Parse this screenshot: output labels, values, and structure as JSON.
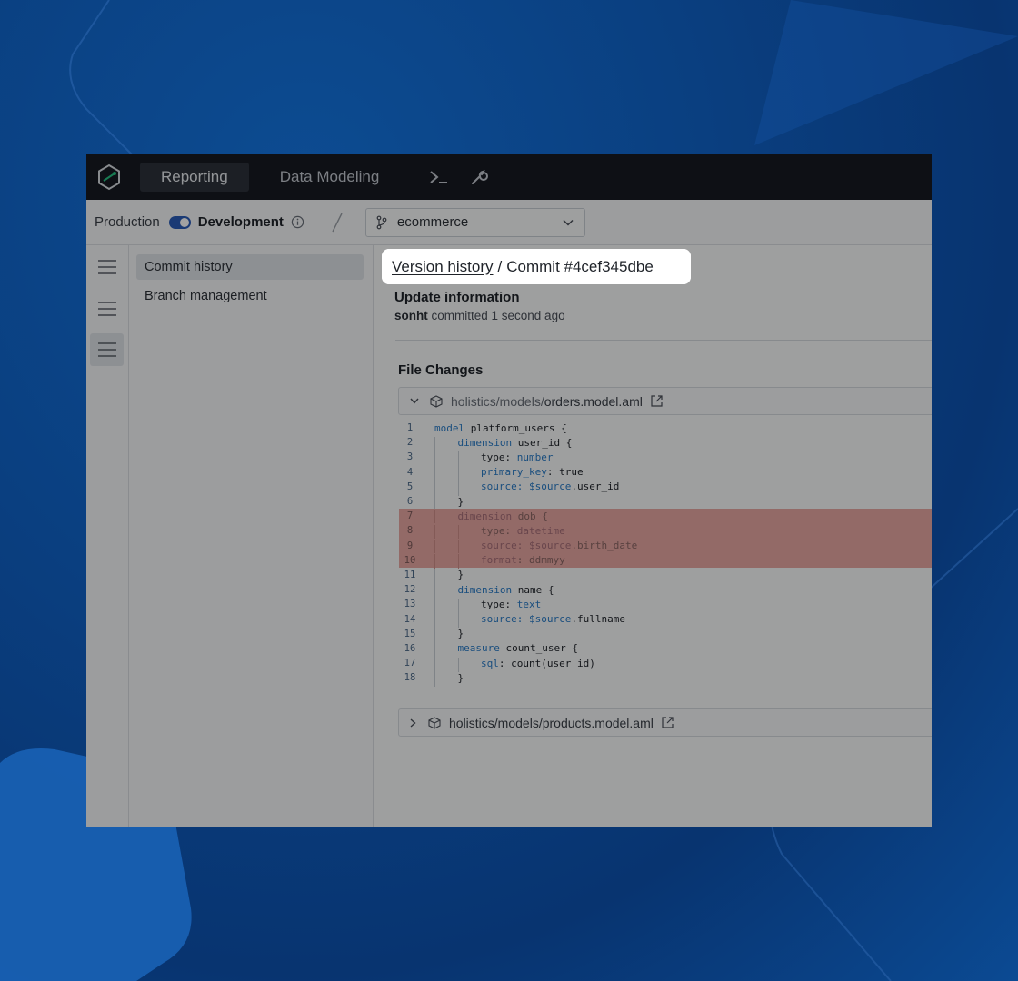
{
  "topbar": {
    "nav": [
      {
        "label": "Reporting",
        "active": true
      },
      {
        "label": "Data Modeling",
        "active": false
      }
    ],
    "tools": [
      "terminal-icon",
      "wrench-icon"
    ]
  },
  "envbar": {
    "production_label": "Production",
    "development_label": "Development",
    "toggle_on": true,
    "branch": "ecommerce"
  },
  "subnav": {
    "items": [
      {
        "label": "Commit history",
        "active": true
      },
      {
        "label": "Branch management",
        "active": false
      }
    ]
  },
  "breadcrumb": {
    "link": "Version history",
    "separator": "/",
    "current": "Commit #4cef345dbe"
  },
  "commit": {
    "section_title": "Update information",
    "author": "sonht",
    "meta": " committed 1 second ago"
  },
  "file_changes": {
    "title": "File Changes",
    "files": [
      {
        "prefix": "holistics/models/",
        "name": "orders.model.aml",
        "expanded": true
      },
      {
        "prefix": "",
        "name": "holistics/models/products.model.aml",
        "expanded": false
      }
    ]
  },
  "code": [
    {
      "n": "1",
      "indent": 0,
      "removed": false,
      "parts": [
        [
          "kw",
          "model"
        ],
        [
          "t",
          " platform_users {"
        ]
      ]
    },
    {
      "n": "2",
      "indent": 1,
      "removed": false,
      "parts": [
        [
          "kw",
          "dimension"
        ],
        [
          "t",
          " user_id {"
        ]
      ]
    },
    {
      "n": "3",
      "indent": 2,
      "removed": false,
      "parts": [
        [
          "t",
          "type: "
        ],
        [
          "kw",
          "number"
        ]
      ]
    },
    {
      "n": "4",
      "indent": 2,
      "removed": false,
      "parts": [
        [
          "kw",
          "primary_key"
        ],
        [
          "t",
          ": true"
        ]
      ]
    },
    {
      "n": "5",
      "indent": 2,
      "removed": false,
      "parts": [
        [
          "kw",
          "source: $source"
        ],
        [
          "t",
          ".user_id"
        ]
      ]
    },
    {
      "n": "6",
      "indent": 1,
      "removed": false,
      "parts": [
        [
          "t",
          "}"
        ]
      ]
    },
    {
      "n": "7",
      "indent": 1,
      "removed": true,
      "parts": [
        [
          "kw",
          "dimension"
        ],
        [
          "t",
          " dob {"
        ]
      ]
    },
    {
      "n": "8",
      "indent": 2,
      "removed": true,
      "parts": [
        [
          "t",
          "type: "
        ],
        [
          "kw",
          "datetime"
        ]
      ]
    },
    {
      "n": "9",
      "indent": 2,
      "removed": true,
      "parts": [
        [
          "kw",
          "source: $source"
        ],
        [
          "t",
          ".birth_date"
        ]
      ]
    },
    {
      "n": "10",
      "indent": 2,
      "removed": true,
      "parts": [
        [
          "kw",
          "format"
        ],
        [
          "t",
          ": ddmmyy"
        ]
      ]
    },
    {
      "n": "11",
      "indent": 1,
      "removed": false,
      "parts": [
        [
          "t",
          "}"
        ]
      ]
    },
    {
      "n": "12",
      "indent": 1,
      "removed": false,
      "parts": [
        [
          "kw",
          "dimension"
        ],
        [
          "t",
          " name {"
        ]
      ]
    },
    {
      "n": "13",
      "indent": 2,
      "removed": false,
      "parts": [
        [
          "t",
          "type: "
        ],
        [
          "kw",
          "text"
        ]
      ]
    },
    {
      "n": "14",
      "indent": 2,
      "removed": false,
      "parts": [
        [
          "kw",
          "source: $source"
        ],
        [
          "t",
          ".fullname"
        ]
      ]
    },
    {
      "n": "15",
      "indent": 1,
      "removed": false,
      "parts": [
        [
          "t",
          "}"
        ]
      ]
    },
    {
      "n": "16",
      "indent": 1,
      "removed": false,
      "parts": [
        [
          "kw",
          "measure"
        ],
        [
          "t",
          " count_user {"
        ]
      ]
    },
    {
      "n": "17",
      "indent": 2,
      "removed": false,
      "parts": [
        [
          "kw",
          "sql"
        ],
        [
          "t",
          ": count(user_id)"
        ]
      ]
    },
    {
      "n": "18",
      "indent": 1,
      "removed": false,
      "parts": [
        [
          "t",
          "}"
        ]
      ]
    }
  ],
  "colors": {
    "background": "#0a3f80",
    "topbar": "#161a21",
    "accent": "#2a5cb8",
    "removed_line": "#e8a7a3",
    "keyword": "#2a7cc7"
  }
}
